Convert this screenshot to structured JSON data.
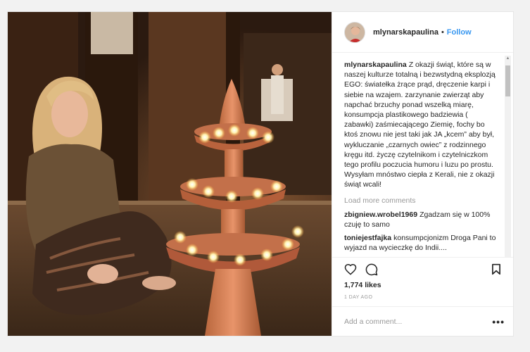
{
  "post": {
    "username": "mlynarskapaulina",
    "dot": "•",
    "follow_label": "Follow",
    "caption_user": "mlynarskapaulina",
    "caption_text": "Z okazji świąt, które są w naszej kulturze totalną i bezwstydną eksplozją EGO: światełka żrące prąd, dręczenie karpi i siebie na wzajem. zarzynanie zwierząt aby napchać brzuchy ponad wszelką miarę, konsumpcja plastikowego badziewia ( zabawki) zaśmiecającego Ziemię, fochy bo ktoś znowu nie jest taki jak JA „kcem” aby był, wykluczanie „czarnych owiec” z rodzinnego kręgu itd. życzę czytelnikom i czytelniczkom tego profilu poczucia humoru i luzu po prostu. Wysyłam mnóstwo ciepła z Kerali, nie z okazji świąt wcali!",
    "load_more": "Load more comments",
    "comments": [
      {
        "user": "zbigniew.wrobel1969",
        "text": "Zgadzam się w 100% czuję to samo"
      },
      {
        "user": "toniejestfajka",
        "text": "konsumpcjonizm Droga Pani to wyjazd na wycieczkę do Indii...."
      }
    ],
    "likes": "1,774 likes",
    "time": "1 DAY AGO",
    "add_comment_placeholder": "Add a comment...",
    "more_label": "•••"
  },
  "icons": {
    "like": "heart-icon",
    "comment": "comment-bubble-icon",
    "save": "bookmark-icon",
    "scroll_up": "arrow-up-icon",
    "scroll_down": "arrow-down-icon"
  }
}
